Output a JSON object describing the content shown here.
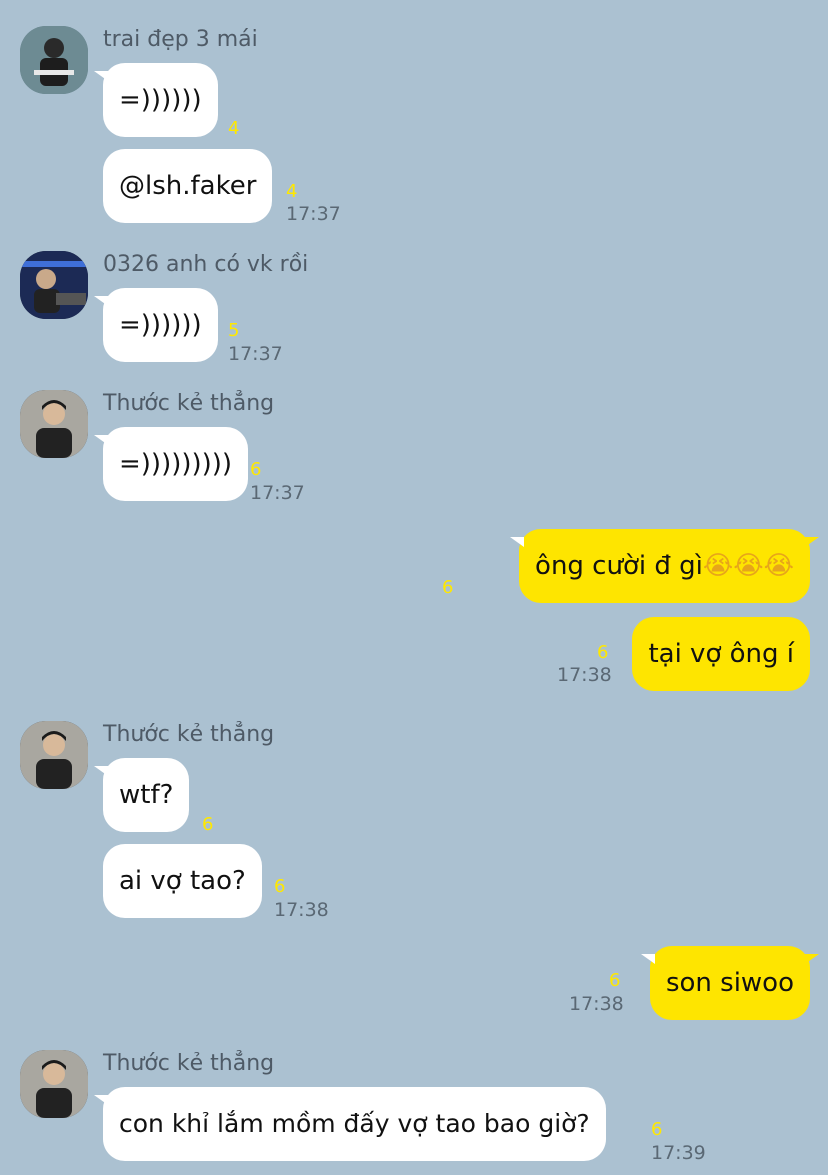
{
  "messages": {
    "m1": {
      "sender": "trai đẹp 3 mái",
      "text": "=))))))",
      "unread": "4"
    },
    "m2": {
      "text": "@lsh.faker",
      "unread": "4",
      "time": "17:37"
    },
    "m3": {
      "sender": "0326 anh có vk rồi",
      "text": "=))))))",
      "unread": "5",
      "time": "17:37"
    },
    "m4": {
      "sender": "Thước kẻ thẳng",
      "text": "=)))))))))",
      "unread": "6",
      "time": "17:37"
    },
    "m5": {
      "text": "ông cười đ gì",
      "emoji": "😭😭😭",
      "unread": "6"
    },
    "m6": {
      "text": "tại vợ ông í",
      "unread": "6",
      "time": "17:38"
    },
    "m7": {
      "sender": "Thước kẻ thẳng",
      "text": "wtf?",
      "unread": "6"
    },
    "m8": {
      "text": "ai vợ tao?",
      "unread": "6",
      "time": "17:38"
    },
    "m9": {
      "text": "son siwoo",
      "unread": "6",
      "time": "17:38"
    },
    "m10": {
      "sender": "Thước kẻ thẳng",
      "text": "con khỉ lắm mồm đấy vợ tao bao giờ?",
      "unread": "6",
      "time": "17:39"
    }
  },
  "colors": {
    "background": "#abc1d1",
    "incoming_bubble": "#ffffff",
    "outgoing_bubble": "#fee500",
    "unread_count": "#ffe800"
  },
  "icons": {
    "avatar_1": "avatar-photo",
    "avatar_2": "avatar-photo",
    "avatar_3": "avatar-photo"
  }
}
